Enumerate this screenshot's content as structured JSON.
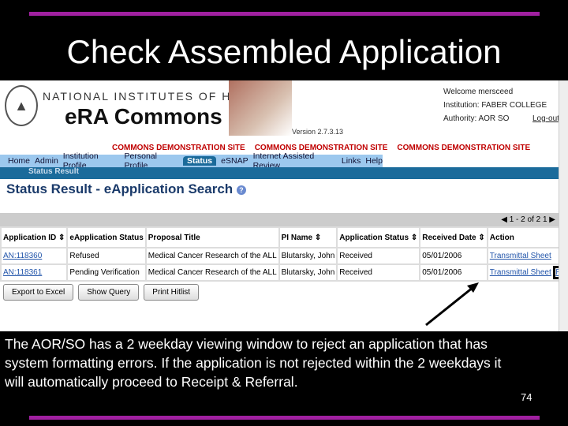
{
  "slide": {
    "title": "Check Assembled Application",
    "note": "The AOR/SO has a 2 weekday viewing window to reject an application that has system formatting errors.  If the application is not rejected within the 2 weekdays it will automatically proceed to Receipt & Referral.",
    "page_number": "74",
    "accent": "#a020a0"
  },
  "header": {
    "org": "NATIONAL INSTITUTES OF HEALTH",
    "app": "eRA Commons",
    "version": "Version 2.7.3.13",
    "welcome": "Welcome mersceed",
    "institution": "Institution: FABER COLLEGE",
    "authority": "Authority: AOR SO",
    "logout": "Log-out",
    "demo": [
      "COMMONS DEMONSTRATION SITE",
      "COMMONS DEMONSTRATION SITE",
      "COMMONS DEMONSTRATION SITE"
    ]
  },
  "nav": [
    "Home",
    "Admin",
    "Institution Profile",
    "Personal Profile",
    "Status",
    "eSNAP",
    "Internet Assisted Review",
    "Links",
    "Help"
  ],
  "subnav": "Status Result",
  "page": {
    "heading": "Status Result - eApplication Search",
    "pagination": "1 - 2 of 2   1"
  },
  "table": {
    "headers": [
      "Application ID",
      "eApplication Status",
      "Proposal Title",
      "PI Name",
      "Application Status",
      "Received Date",
      "Action"
    ],
    "rows": [
      [
        "AN:118360",
        "Refused",
        "Medical Cancer Research of the ALL",
        "Blutarsky, John",
        "Received",
        "05/01/2006",
        "Transmittal Sheet",
        ""
      ],
      [
        "AN:118361",
        "Pending Verification",
        "Medical Cancer Research of the ALL",
        "Blutarsky, John",
        "Received",
        "05/01/2006",
        "Transmittal Sheet",
        "Reject eApplication"
      ]
    ]
  },
  "buttons": [
    "Export to Excel",
    "Show Query",
    "Print Hitlist"
  ]
}
